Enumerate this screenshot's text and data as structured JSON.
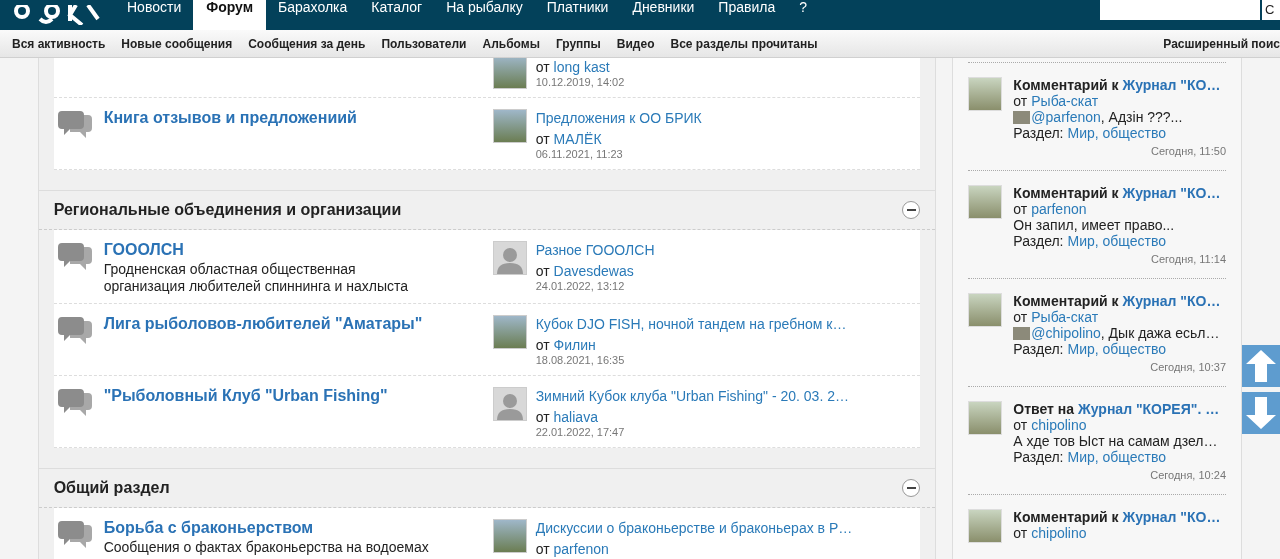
{
  "nav": {
    "tabs": [
      {
        "label": "Новости",
        "selected": false
      },
      {
        "label": "Форум",
        "selected": true
      },
      {
        "label": "Барахолка",
        "selected": false
      },
      {
        "label": "Каталог",
        "selected": false
      },
      {
        "label": "На рыбалку",
        "selected": false
      },
      {
        "label": "Платники",
        "selected": false
      },
      {
        "label": "Дневники",
        "selected": false
      },
      {
        "label": "Правила",
        "selected": false
      },
      {
        "label": "?",
        "selected": false
      }
    ],
    "search_button": "С"
  },
  "subnav": {
    "links": [
      "Вся активность",
      "Новые сообщения",
      "Сообщения за день",
      "Пользователи",
      "Альбомы",
      "Группы",
      "Видео",
      "Все разделы прочитаны"
    ],
    "advanced_search": "Расширенный поис"
  },
  "sections": [
    {
      "forums": [
        {
          "last_post": {
            "default_avatar": false,
            "from_label": "от",
            "author": "long kast",
            "date": "10.12.2019, 14:02"
          }
        },
        {
          "title": "Книга отзывов и предложениий",
          "last_post": {
            "default_avatar": false,
            "title": "Предложения к ОО БРИК",
            "from_label": "от",
            "author": "МАЛЁК",
            "date": "06.11.2021, 11:23"
          }
        }
      ]
    },
    {
      "title": "Региональные объединения и организации",
      "forums": [
        {
          "title": "ГОООЛСН",
          "description": "Гродненская областная общественная организация любителей спиннинга и нахлыста",
          "last_post": {
            "default_avatar": true,
            "title": "Разное ГОООЛСН",
            "from_label": "от",
            "author": "Davesdewas",
            "date": "24.01.2022, 13:12"
          }
        },
        {
          "title": "Лига рыболовов-любителей \"Аматары\"",
          "last_post": {
            "default_avatar": false,
            "title": "Кубок DJO FISH, ночной тандем на гребном к…",
            "from_label": "от",
            "author": "Филин",
            "date": "18.08.2021, 16:35"
          }
        },
        {
          "title": "\"Рыболовный Клуб \"Urban Fishing\"",
          "last_post": {
            "default_avatar": true,
            "title": "Зимний Кубок клуба \"Urban Fishing\" - 20. 03. 2…",
            "from_label": "от",
            "author": "haliava",
            "date": "22.01.2022, 17:47"
          }
        }
      ]
    },
    {
      "title": "Общий раздел",
      "forums": [
        {
          "title": "Борьба с браконьерством",
          "description": "Сообщения о фактах браконьерства на водоемах",
          "last_post": {
            "default_avatar": false,
            "title": "Дискуссии о браконьерстве и браконьерах в Р…",
            "from_label": "от",
            "author": "parfenon"
          }
        }
      ]
    }
  ],
  "activity": [
    {
      "action": "Комментарий к",
      "target": "Журнал \"КО…",
      "from_label": "от",
      "author": "Рыба-скат",
      "excerpt": {
        "mention": "@parfenon",
        "text": ", Адзін ???..."
      },
      "section_label": "Раздел:",
      "section": "Мир, общество",
      "time": "Сегодня, 11:50"
    },
    {
      "action": "Комментарий к",
      "target": "Журнал \"КО…",
      "from_label": "от",
      "author": "parfenon",
      "excerpt": {
        "text": "Он запил, имеет право..."
      },
      "section_label": "Раздел:",
      "section": "Мир, общество",
      "time": "Сегодня, 11:14"
    },
    {
      "action": "Комментарий к",
      "target": "Журнал \"КО…",
      "from_label": "от",
      "author": "Рыба-скат",
      "excerpt": {
        "mention": "@chipolino",
        "text": ", Дык дажа есьл…"
      },
      "section_label": "Раздел:",
      "section": "Мир, общество",
      "time": "Сегодня, 10:37"
    },
    {
      "action": "Ответ на",
      "target": "Журнал \"КОРЕЯ\". …",
      "from_label": "от",
      "author": "chipolino",
      "excerpt": {
        "text": "А хде тов Ыст на самам дзел…"
      },
      "section_label": "Раздел:",
      "section": "Мир, общество",
      "time": "Сегодня, 10:24"
    },
    {
      "action": "Комментарий к",
      "target": "Журнал \"КО…",
      "from_label": "от",
      "author": "chipolino"
    }
  ]
}
